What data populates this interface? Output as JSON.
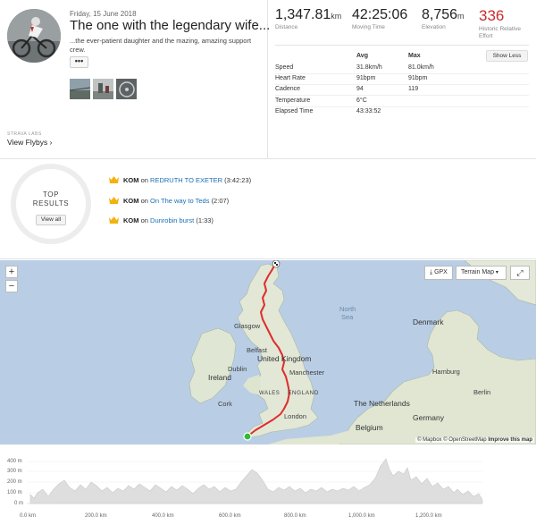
{
  "activity": {
    "date": "Friday, 15 June 2018",
    "title": "The one with the legendary wife...",
    "description": "...the ever-patient daughter and the mazing, amazing support crew.",
    "more_label": "•••",
    "photos": [
      "photo-road",
      "photo-cycle-yard",
      "photo-bike-wheel"
    ],
    "labs_label": "STRAVA LABS",
    "flyby_label": "View Flybys"
  },
  "summary": [
    {
      "value": "1,347.81",
      "unit": "km",
      "label": "Distance",
      "color": "#222222"
    },
    {
      "value": "42:25:06",
      "unit": "",
      "label": "Moving Time",
      "color": "#222222"
    },
    {
      "value": "8,756",
      "unit": "m",
      "label": "Elevation",
      "color": "#222222"
    },
    {
      "value": "336",
      "unit": "",
      "label": "Historic Relative Effort",
      "color": "#cc2b2b"
    }
  ],
  "stats_table": {
    "headers": [
      "",
      "Avg",
      "Max"
    ],
    "show_less_label": "Show Less",
    "rows": [
      [
        "Speed",
        "31.8km/h",
        "81.0km/h"
      ],
      [
        "Heart Rate",
        "91bpm",
        "91bpm"
      ],
      [
        "Cadence",
        "94",
        "119"
      ],
      [
        "Temperature",
        "6°C",
        ""
      ],
      [
        "Elapsed Time",
        "43:33:52",
        ""
      ]
    ]
  },
  "top_results": {
    "title_line1": "TOP",
    "title_line2": "RESULTS",
    "view_all_label": "View all",
    "achievements": [
      {
        "badge": "KOM",
        "on": "on",
        "segment": "REDRUTH TO EXETER",
        "time": "(3:42:23)"
      },
      {
        "badge": "KOM",
        "on": "on",
        "segment": "On The way to Teds",
        "time": "(2:07)"
      },
      {
        "badge": "KOM",
        "on": "on",
        "segment": "Dunrobin burst",
        "time": "(1:33)"
      }
    ],
    "crown_color": "#f2b310"
  },
  "map": {
    "zoom_in": "+",
    "zoom_out": "−",
    "gpx_label": "GPX",
    "terrain_label": "Terrain Map",
    "fullscreen_icon": "expand-icon",
    "route_color": "#e02c2c",
    "labels": {
      "glasgow": "Glasgow",
      "belfast": "Belfast",
      "united_kingdom": "United Kingdom",
      "manchester": "Manchester",
      "dublin": "Dublin",
      "ireland": "Ireland",
      "cork": "Cork",
      "wales": "WALES",
      "england": "ENGLAND",
      "london": "London",
      "north_sea_1": "North",
      "north_sea_2": "Sea",
      "denmark": "Denmark",
      "hamburg": "Hamburg",
      "the_netherlands": "The Netherlands",
      "berlin": "Berlin",
      "germany": "Germany",
      "belgium": "Belgium"
    },
    "attribution_prefix": "© Mapbox © OpenStreetMap",
    "attribution_link": "Improve this map"
  },
  "elevation": {
    "y_labels": [
      "400 m",
      "300 m",
      "200 m",
      "100 m",
      "0 m"
    ],
    "x_labels": [
      "0.0 km",
      "200.0 km",
      "400.0 km",
      "600.0 km",
      "800.0 km",
      "1,000.0 km",
      "1,200.0 km"
    ],
    "fill_color": "#dedede"
  }
}
